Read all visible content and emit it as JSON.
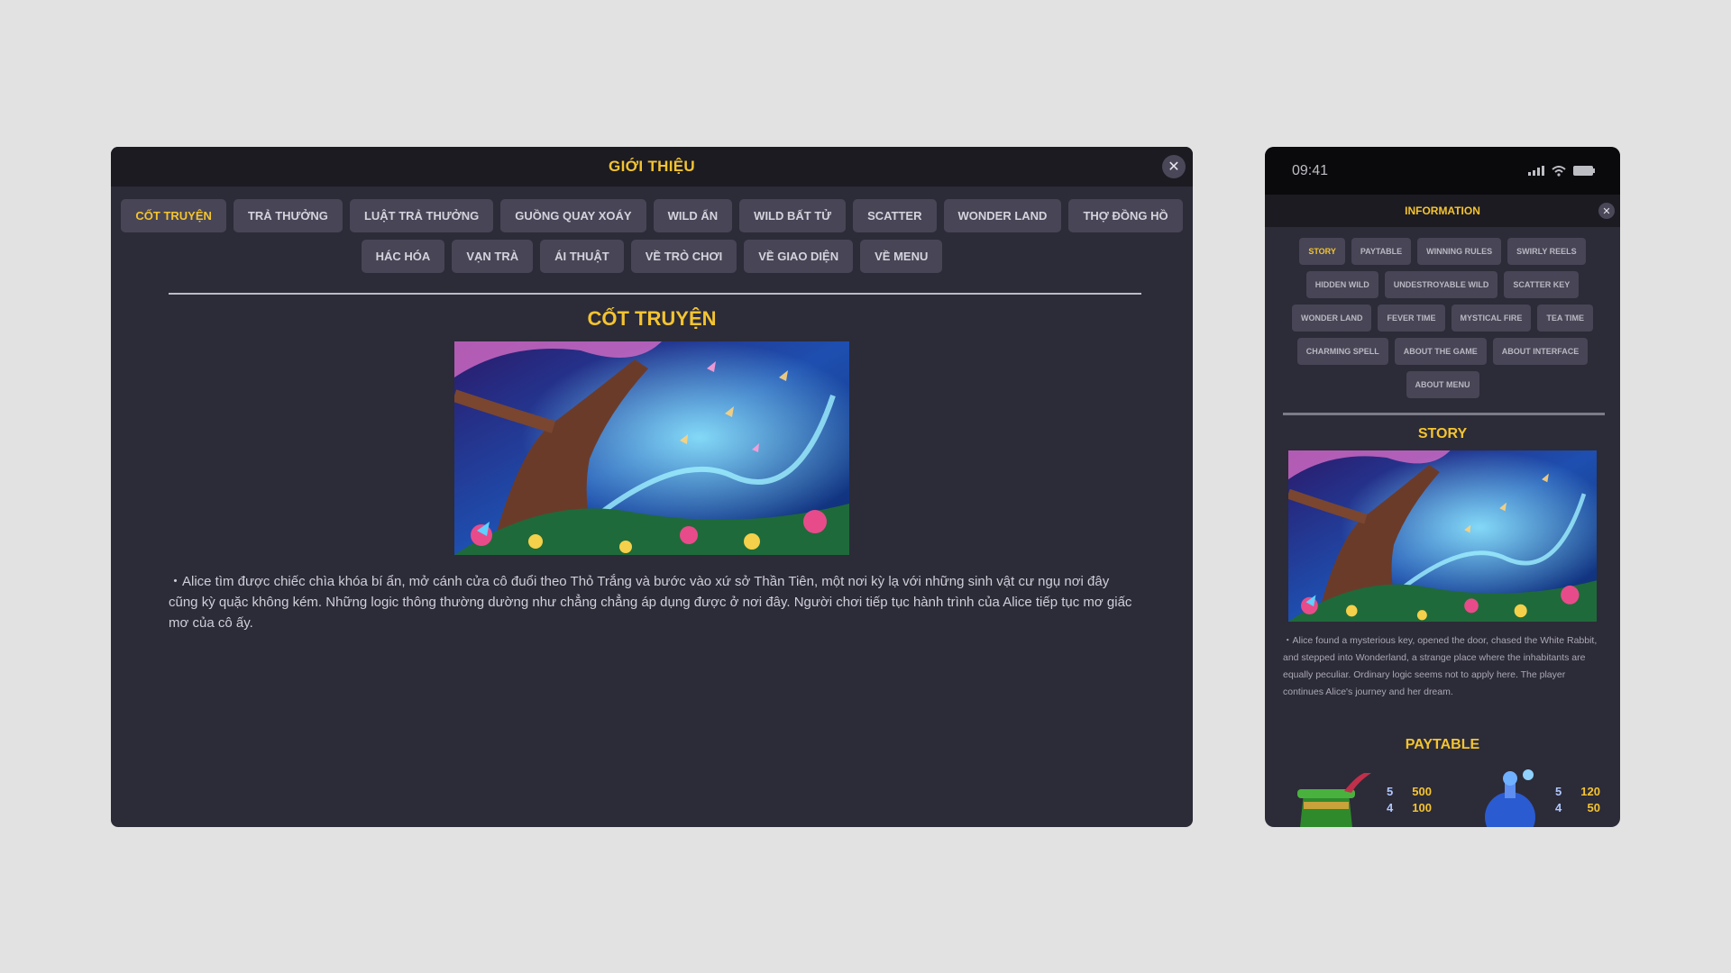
{
  "desktop": {
    "title": "GIỚI THIỆU",
    "close_icon": "close-icon",
    "tabs": [
      {
        "label": "CỐT TRUYỆN",
        "active": true
      },
      {
        "label": "TRẢ THƯỞNG"
      },
      {
        "label": "LUẬT TRẢ THƯỞNG"
      },
      {
        "label": "GUỒNG QUAY XOÁY"
      },
      {
        "label": "WILD ẨN"
      },
      {
        "label": "WILD BẤT TỬ"
      },
      {
        "label": "SCATTER"
      },
      {
        "label": "WONDER LAND"
      },
      {
        "label": "THỢ ĐỒNG HỒ"
      },
      {
        "label": "HÁC HÓA"
      },
      {
        "label": "VẠN TRÀ"
      },
      {
        "label": "ÁI THUẬT"
      },
      {
        "label": "VỀ TRÒ CHƠI"
      },
      {
        "label": "VỀ GIAO DIỆN"
      },
      {
        "label": "VỀ MENU"
      }
    ],
    "section_title": "CỐT TRUYỆN",
    "story_text": "・Alice tìm được chiếc chìa khóa bí ẩn, mở cánh cửa cô đuổi theo Thỏ Trắng và bước vào xứ sở Thần Tiên, một nơi kỳ lạ với những sinh vật cư ngụ nơi đây cũng kỳ quặc không kém. Những logic thông thường dường như chẳng chẳng áp dụng được ở nơi đây. Người chơi tiếp tục hành trình của Alice tiếp tục mơ giấc mơ của cô ấy."
  },
  "mobile": {
    "status_time": "09:41",
    "title": "INFORMATION",
    "tabs": [
      {
        "label": "STORY",
        "active": true
      },
      {
        "label": "PAYTABLE"
      },
      {
        "label": "WINNING RULES"
      },
      {
        "label": "SWIRLY REELS"
      },
      {
        "label": "HIDDEN WILD"
      },
      {
        "label": "UNDESTROYABLE WILD"
      },
      {
        "label": "SCATTER KEY"
      },
      {
        "label": "WONDER LAND"
      },
      {
        "label": "FEVER TIME"
      },
      {
        "label": "MYSTICAL FIRE"
      },
      {
        "label": "TEA TIME"
      },
      {
        "label": "CHARMING SPELL"
      },
      {
        "label": "ABOUT THE GAME"
      },
      {
        "label": "ABOUT INTERFACE"
      },
      {
        "label": "ABOUT MENU"
      }
    ],
    "section_title": "STORY",
    "story_text": "・Alice found a mysterious key, opened the door, chased the White Rabbit, and stepped into Wonderland, a strange place where the inhabitants are equally peculiar. Ordinary logic seems not to apply here. The player continues Alice's journey and her dream.",
    "paytable_title": "PAYTABLE",
    "paytable": [
      {
        "symbol": "green-top-hat-symbol",
        "rows": [
          {
            "count": "5",
            "amount": "500"
          },
          {
            "count": "4",
            "amount": "100"
          }
        ]
      },
      {
        "symbol": "blue-potion-symbol",
        "rows": [
          {
            "count": "5",
            "amount": "120"
          },
          {
            "count": "4",
            "amount": "50"
          }
        ]
      }
    ]
  },
  "colors": {
    "accent": "#f4c430",
    "panel": "#2c2b38",
    "header": "#1c1b22",
    "tab": "#474556"
  }
}
